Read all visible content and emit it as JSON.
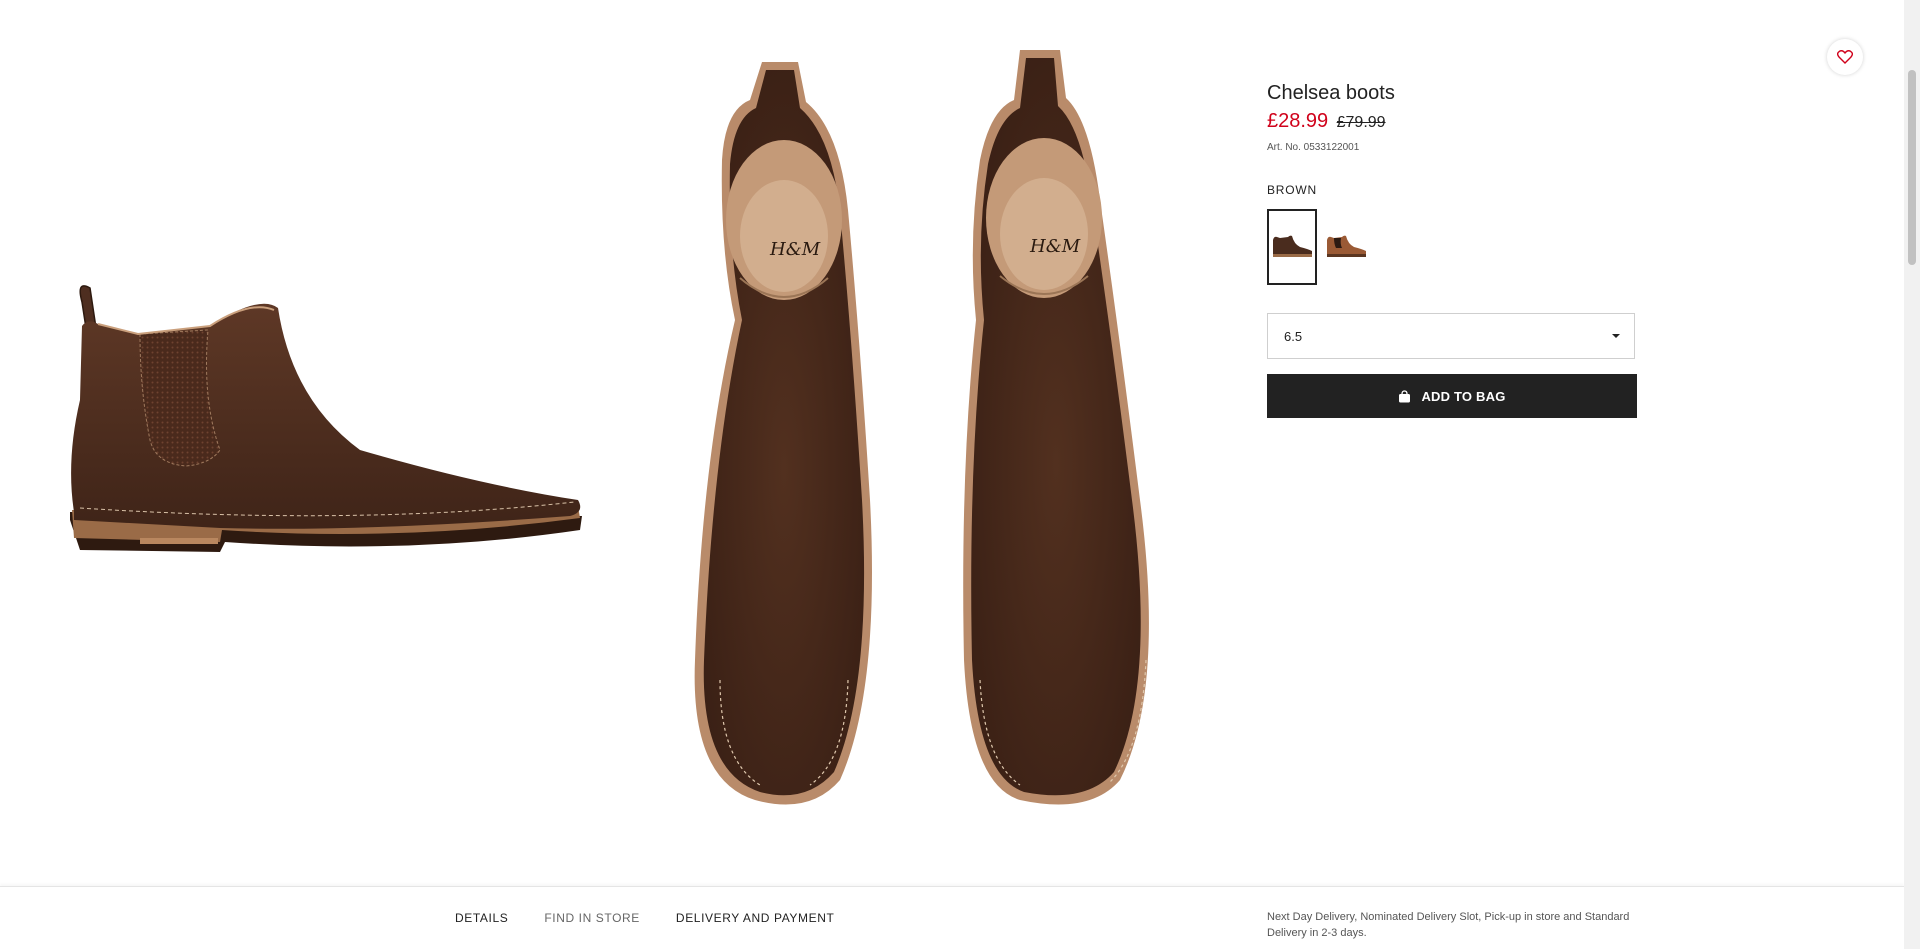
{
  "product": {
    "title": "Chelsea boots",
    "price_sale": "£28.99",
    "price_old": "£79.99",
    "article_number": "Art. No. 0533122001",
    "color_label": "BROWN",
    "colors": [
      "#4a2c1e",
      "#9a5a35"
    ],
    "size_value": "6.5",
    "add_to_bag_label": "ADD TO BAG",
    "brand_mark": "H&M"
  },
  "tabs": [
    "DETAILS",
    "FIND IN STORE",
    "DELIVERY AND PAYMENT"
  ],
  "delivery_note": "Next Day Delivery, Nominated Delivery Slot, Pick-up in store and Standard Delivery in 2-3 days.",
  "icons": {
    "favorite": "heart-icon",
    "bag": "shopping-bag-icon",
    "dropdown": "caret-down-icon"
  },
  "accent_colors": {
    "sale_red": "#d0021b",
    "button": "#222222"
  }
}
